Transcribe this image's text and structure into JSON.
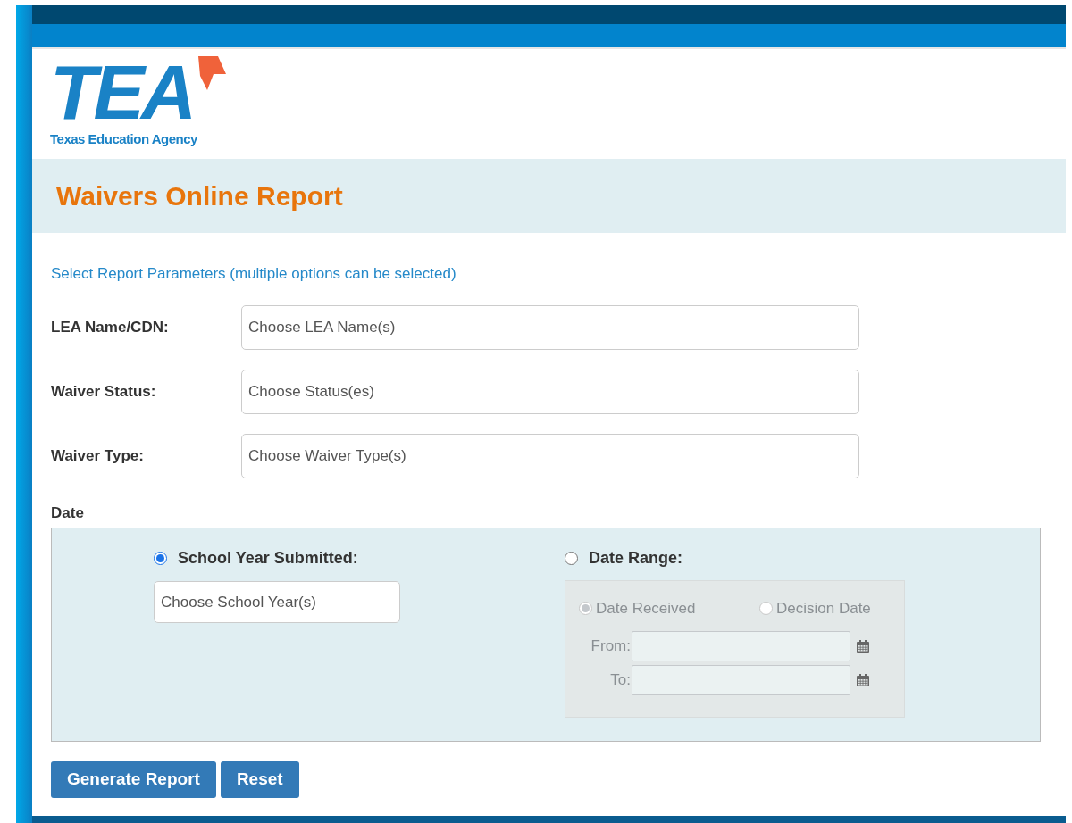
{
  "logo": {
    "letters": "TEA",
    "agency": "Texas Education Agency"
  },
  "page_title": "Waivers Online Report",
  "instructions": "Select Report Parameters (multiple options can be selected)",
  "fields": [
    {
      "label": "LEA Name/CDN:",
      "placeholder": "Choose LEA Name(s)"
    },
    {
      "label": "Waiver Status:",
      "placeholder": "Choose Status(es)"
    },
    {
      "label": "Waiver Type:",
      "placeholder": "Choose Waiver Type(s)"
    }
  ],
  "date": {
    "heading": "Date",
    "school_year": {
      "label": "School Year Submitted:",
      "selected": true,
      "placeholder": "Choose School Year(s)"
    },
    "date_range": {
      "label": "Date Range:",
      "selected": false,
      "disabled": true,
      "options": [
        {
          "label": "Date Received",
          "selected": true
        },
        {
          "label": "Decision Date",
          "selected": false
        }
      ],
      "from_label": "From:",
      "to_label": "To:"
    }
  },
  "buttons": [
    "Generate Report",
    "Reset"
  ]
}
